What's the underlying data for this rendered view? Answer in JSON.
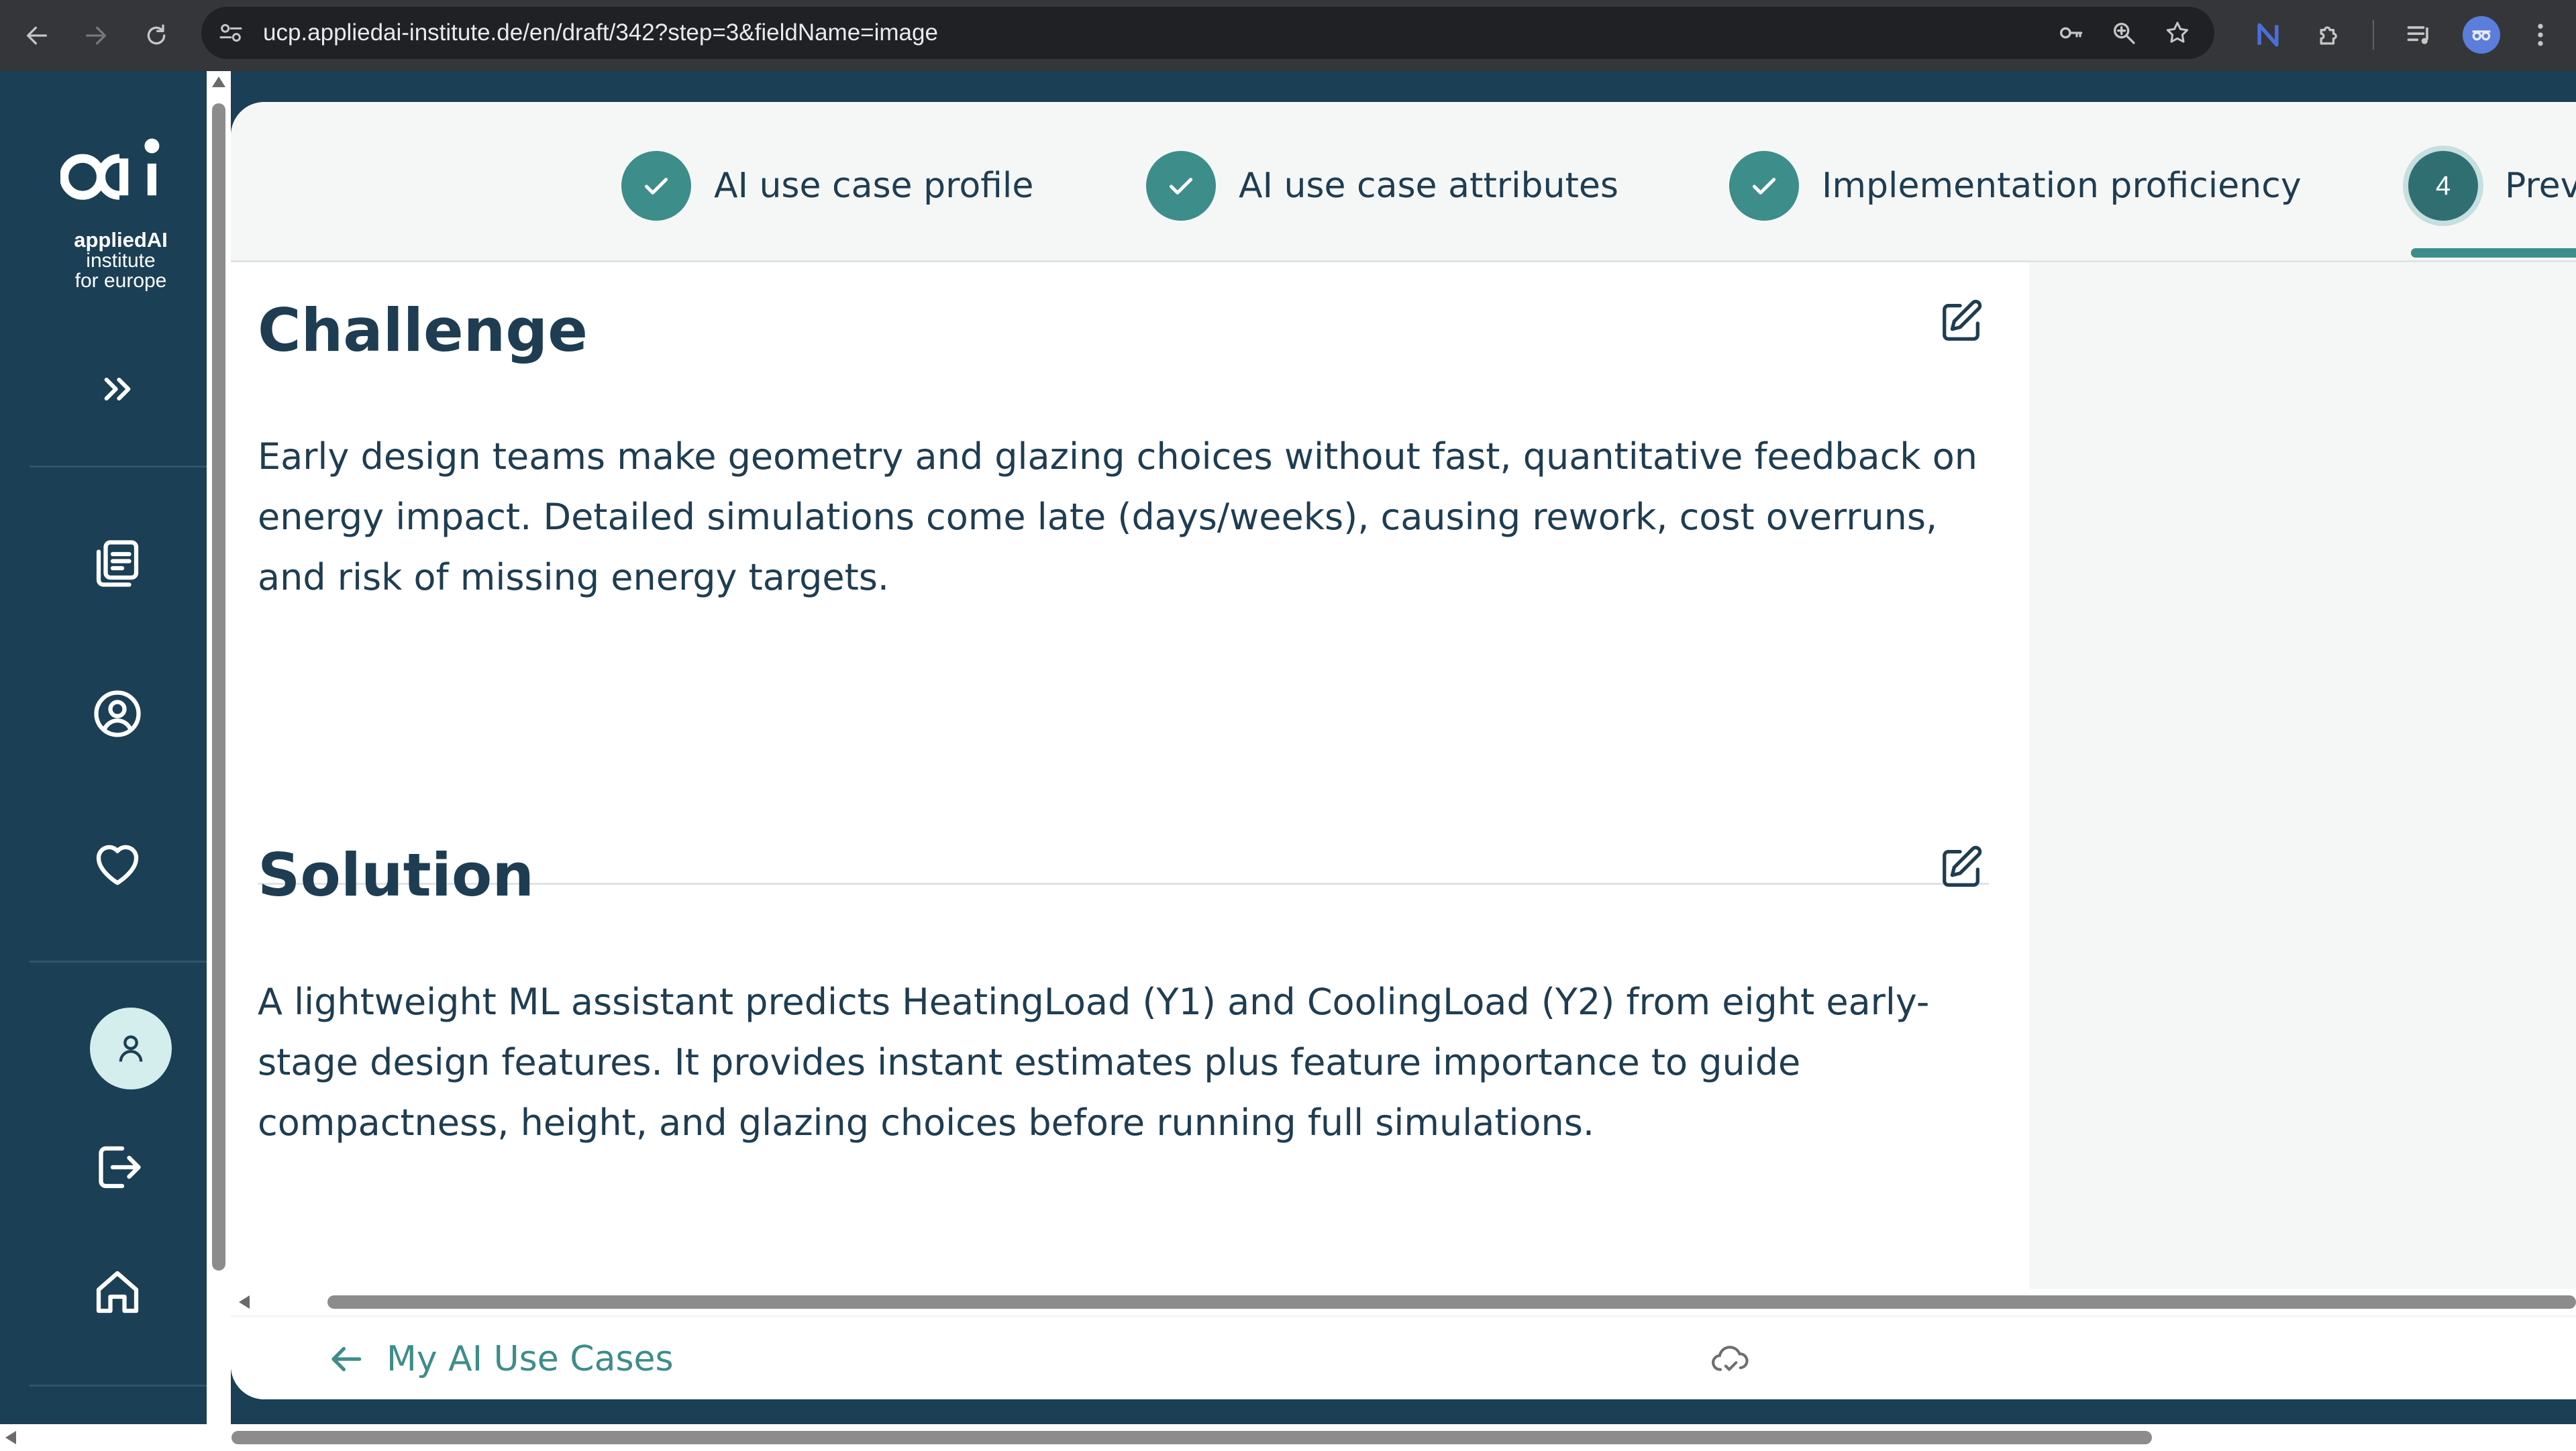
{
  "browser": {
    "url": "ucp.appliedai-institute.de/en/draft/342?step=3&fieldName=image",
    "icons": [
      "back-arrow-icon",
      "forward-arrow-icon",
      "reload-icon",
      "site-info-icon",
      "password-key-icon",
      "zoom-icon",
      "bookmark-star-icon",
      "extension-n-icon",
      "extensions-puzzle-icon",
      "media-control-icon",
      "profile-icon",
      "menu-dots-icon"
    ]
  },
  "sidebar": {
    "logo": {
      "line1": "appliedAI",
      "line2": "institute",
      "line3": "for europe"
    },
    "icons": [
      "expand-chevrons-icon",
      "documents-icon",
      "user-circle-icon",
      "heart-icon",
      "user-icon",
      "logout-icon",
      "home-icon"
    ]
  },
  "stepper": {
    "steps": [
      {
        "label": "AI use case profile",
        "state": "completed"
      },
      {
        "label": "AI use case attributes",
        "state": "completed"
      },
      {
        "label": "Implementation proficiency",
        "state": "completed"
      },
      {
        "number": "4",
        "label": "Prev",
        "state": "active"
      }
    ]
  },
  "sections": {
    "challenge": {
      "title": "Challenge",
      "text": "Early design teams make geometry and glazing choices without fast, quantitative feedback on energy impact. Detailed simulations come late (days/weeks), causing rework, cost overruns, and risk of missing energy targets."
    },
    "solution": {
      "title": "Solution",
      "text": "A lightweight ML assistant predicts HeatingLoad (Y1) and CoolingLoad (Y2) from eight early-stage design features. It provides instant estimates plus feature importance to guide compactness, height, and glazing choices before running full simulations."
    }
  },
  "footer": {
    "back_label": "My AI Use Cases",
    "save_status_icon": "cloud-saved-icon"
  },
  "colors": {
    "sidebar_bg": "#1b3f55",
    "accent": "#3d8d8a",
    "text_dark": "#1e3d52",
    "panel_bg": "#f5f7f7"
  }
}
